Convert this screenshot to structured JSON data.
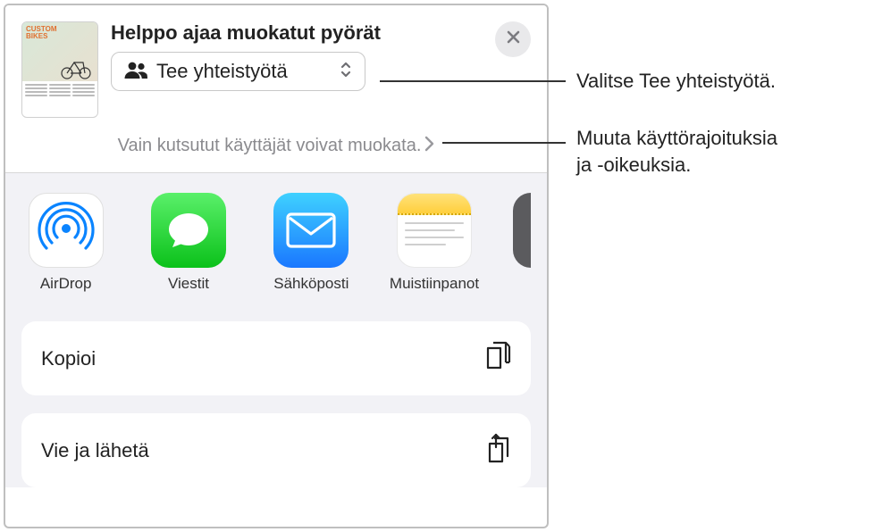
{
  "header": {
    "title": "Helppo ajaa muokatut pyörät",
    "thumb_badge": "CUSTOM\nBIKES"
  },
  "collab": {
    "label": "Tee yhteistyötä"
  },
  "permissions": {
    "text": "Vain kutsutut käyttäjät voivat muokata."
  },
  "apps": {
    "airdrop": "AirDrop",
    "messages": "Viestit",
    "mail": "Sähköposti",
    "notes": "Muistiinpanot"
  },
  "actions": {
    "copy": "Kopioi",
    "export": "Vie ja lähetä"
  },
  "callouts": {
    "collab": "Valitse Tee yhteistyötä.",
    "permissions": "Muuta käyttörajoituksia\nja -oikeuksia."
  }
}
